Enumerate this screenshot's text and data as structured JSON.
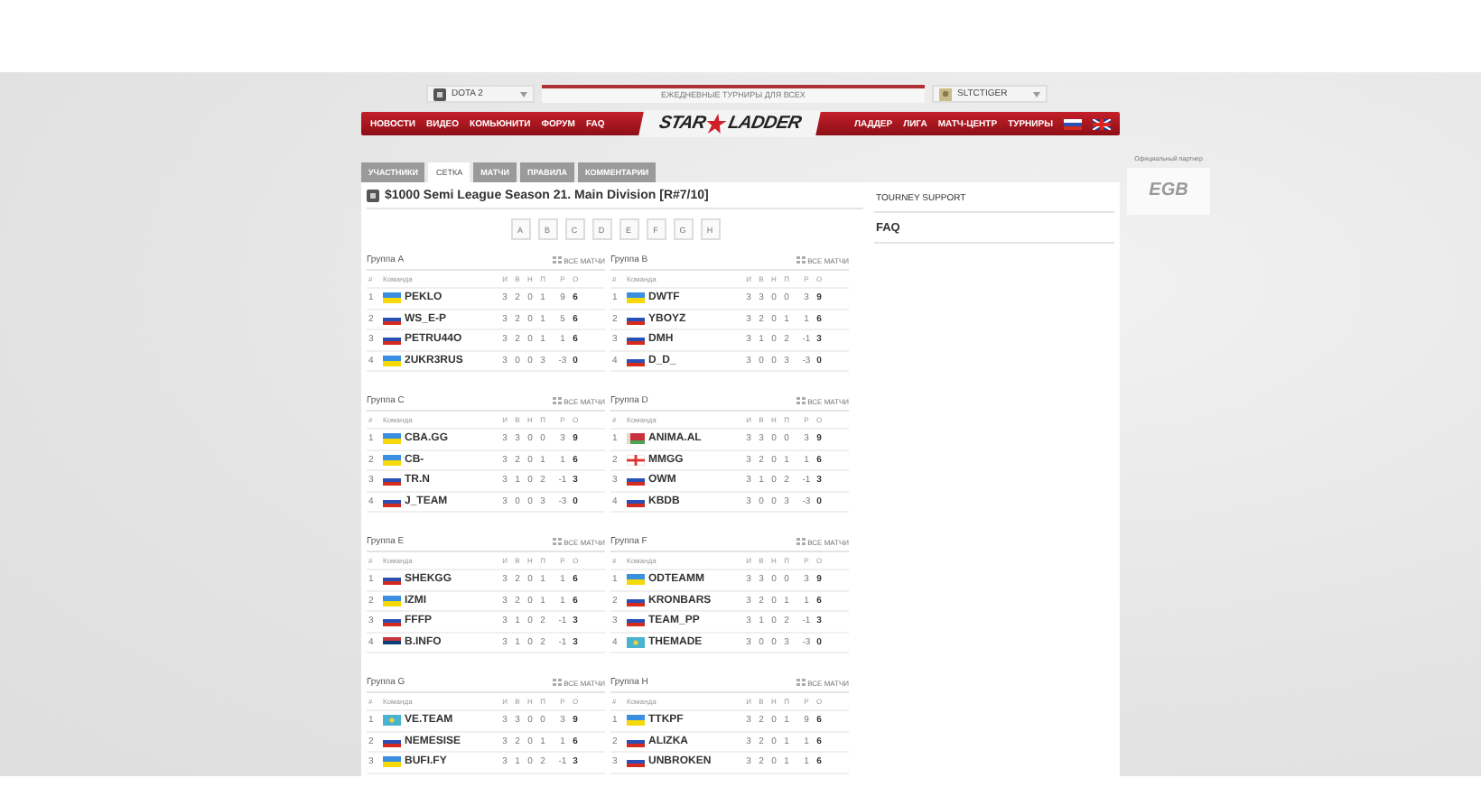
{
  "top_bar": {
    "game_select": "DOTA 2",
    "banner": "ЕЖЕДНЕВНЫЕ ТУРНИРЫ ДЛЯ ВСЕХ",
    "user_select": "SLTCTIGER"
  },
  "nav": {
    "left": [
      "НОВОСТИ",
      "ВИДЕО",
      "КОМЬЮНИТИ",
      "ФОРУМ",
      "FAQ"
    ],
    "logo": {
      "left": "STAR",
      "right": "LADDER"
    },
    "right": [
      "ЛАДДЕР",
      "ЛИГА",
      "МАТЧ-ЦЕНТР",
      "ТУРНИРЫ"
    ],
    "languages": [
      {
        "kind": "ru"
      },
      {
        "kind": "gb"
      }
    ]
  },
  "tabs": [
    {
      "label": "УЧАСТНИКИ",
      "selected": false
    },
    {
      "label": "СЕТКА",
      "selected": true
    },
    {
      "label": "МАТЧИ",
      "selected": false
    },
    {
      "label": "ПРАВИЛА",
      "selected": false
    },
    {
      "label": "КОММЕНТАРИИ",
      "selected": false
    }
  ],
  "tournament_title": "$1000 Semi League Season 21. Main Division [R#7/10]",
  "group_buttons": [
    "A",
    "B",
    "C",
    "D",
    "E",
    "F",
    "G",
    "H"
  ],
  "groups": [
    {
      "title": "Группа A",
      "link": "ВСЕ МАТЧИ",
      "columns": [
        "#",
        "Команда",
        "И",
        "В",
        "Н",
        "П",
        "Р",
        "О"
      ],
      "rows": [
        {
          "rank": "1",
          "kind": "ua",
          "team": "PEKLO",
          "stats": [
            "3",
            "2",
            "0",
            "1",
            "9",
            "6"
          ]
        },
        {
          "rank": "2",
          "kind": "ru",
          "team": "WS_E-P",
          "stats": [
            "3",
            "2",
            "0",
            "1",
            "5",
            "6"
          ]
        },
        {
          "rank": "3",
          "kind": "ru",
          "team": "PETRU44O",
          "stats": [
            "3",
            "2",
            "0",
            "1",
            "1",
            "6"
          ]
        },
        {
          "rank": "4",
          "kind": "ua",
          "team": "2UKR3RUS",
          "stats": [
            "3",
            "0",
            "0",
            "3",
            "-3",
            "0"
          ]
        }
      ]
    },
    {
      "title": "Группа B",
      "link": "ВСЕ МАТЧИ",
      "columns": [
        "#",
        "Команда",
        "И",
        "В",
        "Н",
        "П",
        "Р",
        "О"
      ],
      "rows": [
        {
          "rank": "1",
          "kind": "ua",
          "team": "DWTF",
          "stats": [
            "3",
            "3",
            "0",
            "0",
            "3",
            "9"
          ]
        },
        {
          "rank": "2",
          "kind": "ru",
          "team": "YBOYZ",
          "stats": [
            "3",
            "2",
            "0",
            "1",
            "1",
            "6"
          ]
        },
        {
          "rank": "3",
          "kind": "ru",
          "team": "DMH",
          "stats": [
            "3",
            "1",
            "0",
            "2",
            "-1",
            "3"
          ]
        },
        {
          "rank": "4",
          "kind": "ru",
          "team": "D_D_",
          "stats": [
            "3",
            "0",
            "0",
            "3",
            "-3",
            "0"
          ]
        }
      ]
    },
    {
      "title": "Группа C",
      "link": "ВСЕ МАТЧИ",
      "columns": [
        "#",
        "Команда",
        "И",
        "В",
        "Н",
        "П",
        "Р",
        "О"
      ],
      "rows": [
        {
          "rank": "1",
          "kind": "ua",
          "team": "CBA.GG",
          "stats": [
            "3",
            "3",
            "0",
            "0",
            "3",
            "9"
          ]
        },
        {
          "rank": "2",
          "kind": "ua",
          "team": "CB-",
          "stats": [
            "3",
            "2",
            "0",
            "1",
            "1",
            "6"
          ]
        },
        {
          "rank": "3",
          "kind": "ru",
          "team": "TR.N",
          "stats": [
            "3",
            "1",
            "0",
            "2",
            "-1",
            "3"
          ]
        },
        {
          "rank": "4",
          "kind": "ru",
          "team": "J_TEAM",
          "stats": [
            "3",
            "0",
            "0",
            "3",
            "-3",
            "0"
          ]
        }
      ]
    },
    {
      "title": "Группа D",
      "link": "ВСЕ МАТЧИ",
      "columns": [
        "#",
        "Команда",
        "И",
        "В",
        "Н",
        "П",
        "Р",
        "О"
      ],
      "rows": [
        {
          "rank": "1",
          "kind": "by",
          "team": "ANIMA.AL",
          "stats": [
            "3",
            "3",
            "0",
            "0",
            "3",
            "9"
          ]
        },
        {
          "rank": "2",
          "kind": "ge",
          "team": "MMGG",
          "stats": [
            "3",
            "2",
            "0",
            "1",
            "1",
            "6"
          ]
        },
        {
          "rank": "3",
          "kind": "ru",
          "team": "OWM",
          "stats": [
            "3",
            "1",
            "0",
            "2",
            "-1",
            "3"
          ]
        },
        {
          "rank": "4",
          "kind": "ru",
          "team": "KBDB",
          "stats": [
            "3",
            "0",
            "0",
            "3",
            "-3",
            "0"
          ]
        }
      ]
    },
    {
      "title": "Группа E",
      "link": "ВСЕ МАТЧИ",
      "columns": [
        "#",
        "Команда",
        "И",
        "В",
        "Н",
        "П",
        "Р",
        "О"
      ],
      "rows": [
        {
          "rank": "1",
          "kind": "ru",
          "team": "SHEKGG",
          "stats": [
            "3",
            "2",
            "0",
            "1",
            "1",
            "6"
          ]
        },
        {
          "rank": "2",
          "kind": "ua",
          "team": "IZMI",
          "stats": [
            "3",
            "2",
            "0",
            "1",
            "1",
            "6"
          ]
        },
        {
          "rank": "3",
          "kind": "ru",
          "team": "FFFP",
          "stats": [
            "3",
            "1",
            "0",
            "2",
            "-1",
            "3"
          ]
        },
        {
          "rank": "4",
          "kind": "rs",
          "team": "B.INFO",
          "stats": [
            "3",
            "1",
            "0",
            "2",
            "-1",
            "3"
          ]
        }
      ]
    },
    {
      "title": "Группа F",
      "link": "ВСЕ МАТЧИ",
      "columns": [
        "#",
        "Команда",
        "И",
        "В",
        "Н",
        "П",
        "Р",
        "О"
      ],
      "rows": [
        {
          "rank": "1",
          "kind": "ua",
          "team": "ODTEAMM",
          "stats": [
            "3",
            "3",
            "0",
            "0",
            "3",
            "9"
          ]
        },
        {
          "rank": "2",
          "kind": "ru",
          "team": "KRONBARS",
          "stats": [
            "3",
            "2",
            "0",
            "1",
            "1",
            "6"
          ]
        },
        {
          "rank": "3",
          "kind": "ru",
          "team": "TEAM_PP",
          "stats": [
            "3",
            "1",
            "0",
            "2",
            "-1",
            "3"
          ]
        },
        {
          "rank": "4",
          "kind": "kz",
          "team": "THEMADE",
          "stats": [
            "3",
            "0",
            "0",
            "3",
            "-3",
            "0"
          ]
        }
      ]
    },
    {
      "title": "Группа G",
      "link": "ВСЕ МАТЧИ",
      "columns": [
        "#",
        "Команда",
        "И",
        "В",
        "Н",
        "П",
        "Р",
        "О"
      ],
      "rows": [
        {
          "rank": "1",
          "kind": "kz",
          "team": "VE.TEAM",
          "stats": [
            "3",
            "3",
            "0",
            "0",
            "3",
            "9"
          ]
        },
        {
          "rank": "2",
          "kind": "ru",
          "team": "NEMESISE",
          "stats": [
            "3",
            "2",
            "0",
            "1",
            "1",
            "6"
          ]
        },
        {
          "rank": "3",
          "kind": "ua",
          "team": "BUFI.FY",
          "stats": [
            "3",
            "1",
            "0",
            "2",
            "-1",
            "3"
          ]
        }
      ]
    },
    {
      "title": "Группа H",
      "link": "ВСЕ МАТЧИ",
      "columns": [
        "#",
        "Команда",
        "И",
        "В",
        "Н",
        "П",
        "Р",
        "О"
      ],
      "rows": [
        {
          "rank": "1",
          "kind": "ua",
          "team": "TTKPF",
          "stats": [
            "3",
            "2",
            "0",
            "1",
            "9",
            "6"
          ]
        },
        {
          "rank": "2",
          "kind": "ru",
          "team": "ALIZKA",
          "stats": [
            "3",
            "2",
            "0",
            "1",
            "1",
            "6"
          ]
        },
        {
          "rank": "3",
          "kind": "ru",
          "team": "UNBROKEN",
          "stats": [
            "3",
            "2",
            "0",
            "1",
            "1",
            "6"
          ]
        }
      ]
    }
  ],
  "sidebar": {
    "items": [
      "TOURNEY SUPPORT",
      "FAQ"
    ]
  },
  "partner": {
    "caption": "Официальный партнер",
    "logo": "EGB"
  }
}
